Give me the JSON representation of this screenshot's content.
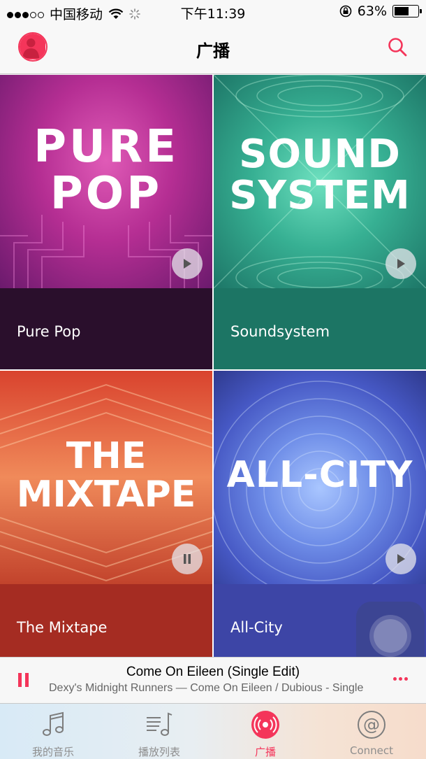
{
  "status_bar": {
    "carrier": "中国移动",
    "time": "下午11:39",
    "battery_percent": "63%",
    "battery_level": 0.63,
    "signal_bars_filled": 3,
    "signal_bars_total": 5
  },
  "nav": {
    "title": "广播",
    "avatar_icon": "user-avatar-icon",
    "search_icon": "search-icon"
  },
  "stations": [
    {
      "art_text": [
        "PURE",
        "POP"
      ],
      "name": "Pure Pop",
      "state": "play",
      "art_colors": [
        "#c2379d",
        "#7a1f7c"
      ],
      "caption_color": "#2a0f2c"
    },
    {
      "art_text": [
        "SOUND",
        "SYSTEM"
      ],
      "name": "Soundsystem",
      "state": "play",
      "art_colors": [
        "#3fb79b",
        "#1f7a6c"
      ],
      "caption_color": "#1c7564"
    },
    {
      "art_text": [
        "THE",
        "MIXTAPE"
      ],
      "name": "The Mixtape",
      "state": "pause",
      "art_colors": [
        "#e86a46",
        "#b83a28"
      ],
      "caption_color": "#a52c22"
    },
    {
      "art_text": [
        "ALL-CITY"
      ],
      "name": "All-City",
      "state": "play",
      "art_colors": [
        "#7da3ef",
        "#3f51b8"
      ],
      "caption_color": "#3d45a6"
    }
  ],
  "mini_player": {
    "song": "Come On Eileen (Single Edit)",
    "artist_line": "Dexy's Midnight Runners — Come On Eileen / Dubious - Single",
    "pause_icon": "pause-icon",
    "more_icon": "more-icon"
  },
  "tabs": [
    {
      "label": "我的音乐",
      "icon": "music-note-icon",
      "active": false
    },
    {
      "label": "播放列表",
      "icon": "playlist-icon",
      "active": false
    },
    {
      "label": "广播",
      "icon": "radio-icon",
      "active": true
    },
    {
      "label": "Connect",
      "icon": "at-icon",
      "active": false
    }
  ],
  "colors": {
    "accent": "#f4355a"
  }
}
